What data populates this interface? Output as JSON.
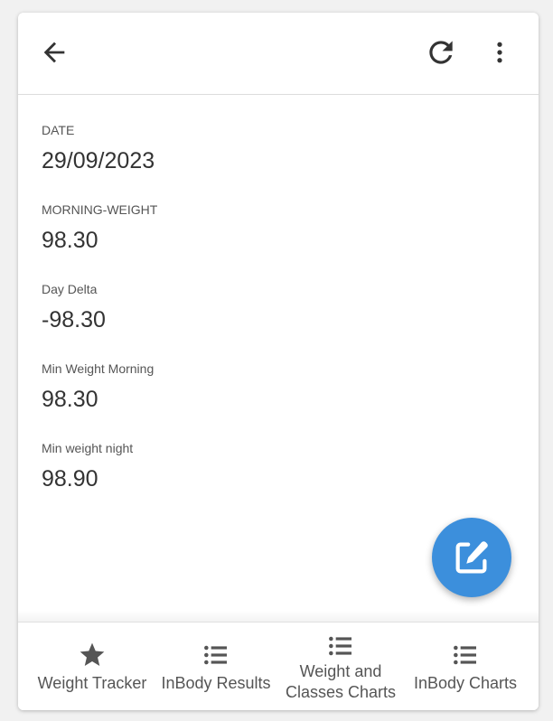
{
  "header": {
    "back_icon": "arrow-left-icon",
    "refresh_icon": "refresh-icon",
    "more_icon": "more-vertical-icon"
  },
  "fields": [
    {
      "label": "DATE",
      "value": "29/09/2023"
    },
    {
      "label": "MORNING-WEIGHT",
      "value": "98.30"
    },
    {
      "label": "Day Delta",
      "value": "-98.30"
    },
    {
      "label": "Min Weight Morning",
      "value": "98.30"
    },
    {
      "label": "Min weight night",
      "value": "98.90"
    }
  ],
  "fab": {
    "icon": "edit-icon",
    "color": "#3c8fdc"
  },
  "bottom_nav": {
    "items": [
      {
        "label": "Weight Tracker",
        "icon": "star-icon"
      },
      {
        "label": "InBody Results",
        "icon": "list-icon"
      },
      {
        "label": "Weight and\nClasses Charts",
        "icon": "list-icon"
      },
      {
        "label": "InBody Charts",
        "icon": "list-icon"
      }
    ]
  }
}
